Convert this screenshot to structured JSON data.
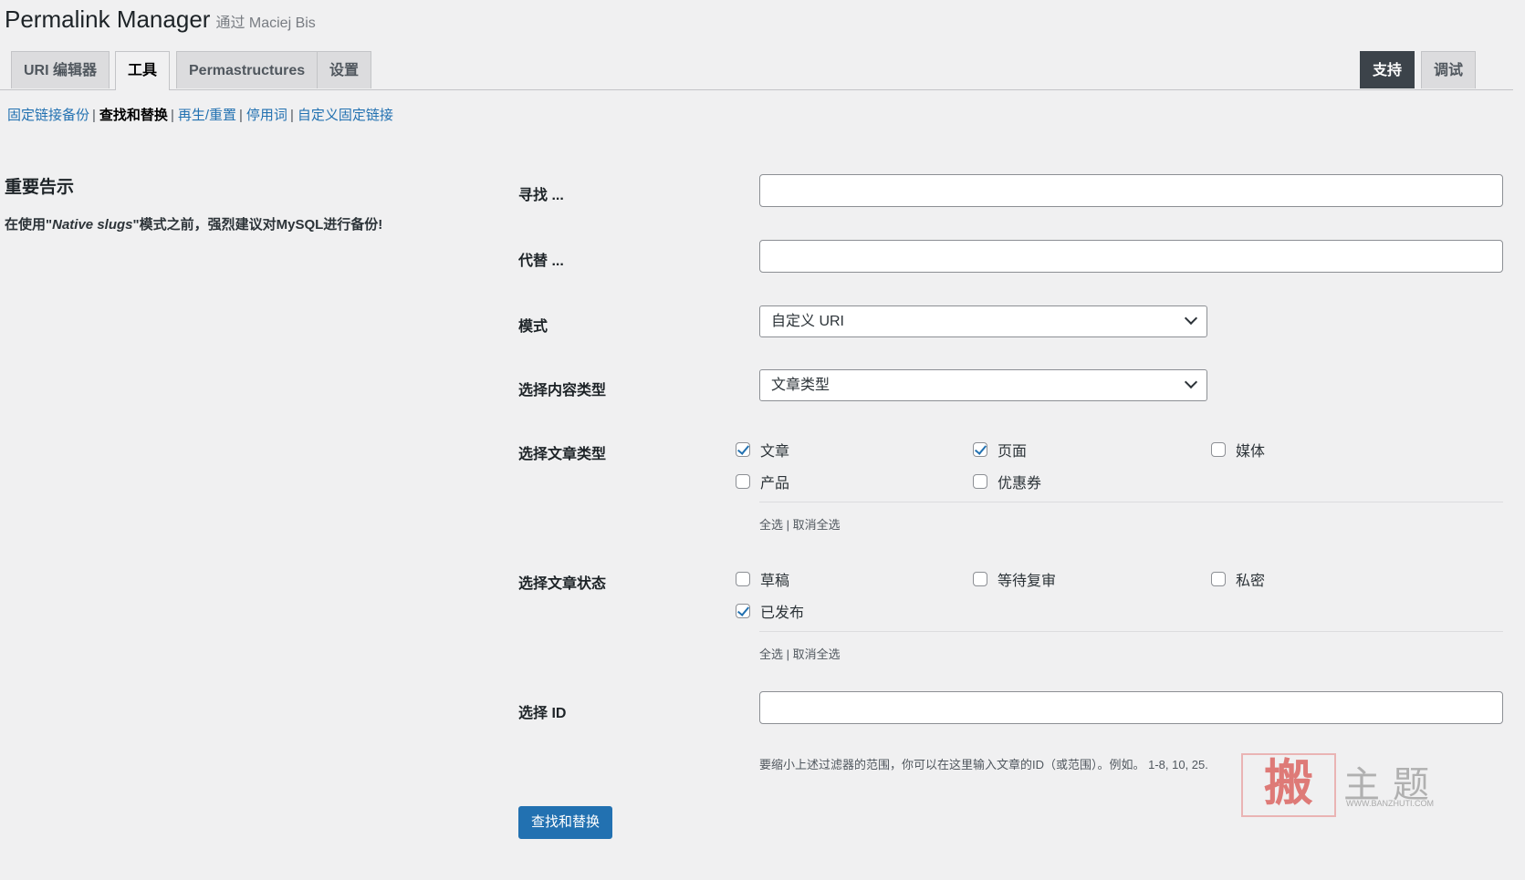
{
  "header": {
    "title": "Permalink Manager",
    "by": "通过 Maciej Bis"
  },
  "tabs": [
    {
      "label": "URI 编辑器"
    },
    {
      "label": "工具"
    },
    {
      "label": "Permastructures"
    },
    {
      "label": "设置"
    }
  ],
  "tabs_right": [
    {
      "label": "支持"
    },
    {
      "label": "调试"
    }
  ],
  "subnav": [
    {
      "label": "固定链接备份"
    },
    {
      "label": "查找和替换"
    },
    {
      "label": "再生/重置"
    },
    {
      "label": "停用词"
    },
    {
      "label": "自定义固定链接"
    }
  ],
  "subnav_sep": "|",
  "notice": {
    "heading": "重要告示",
    "prefix": "在使用\"",
    "italic": "Native slugs",
    "suffix": "\"模式之前，强烈建议对MySQL进行备份!"
  },
  "form": {
    "find_label": "寻找 ...",
    "find_value": "",
    "replace_label": "代替 ...",
    "replace_value": "",
    "mode_label": "模式",
    "mode_value": "自定义 URI",
    "content_type_label": "选择内容类型",
    "content_type_value": "文章类型",
    "post_types_label": "选择文章类型",
    "post_types": [
      {
        "label": "文章",
        "checked": true
      },
      {
        "label": "页面",
        "checked": true
      },
      {
        "label": "媒体",
        "checked": false
      },
      {
        "label": "产品",
        "checked": false
      },
      {
        "label": "优惠券",
        "checked": false
      }
    ],
    "post_status_label": "选择文章状态",
    "post_statuses": [
      {
        "label": "草稿",
        "checked": false
      },
      {
        "label": "等待复审",
        "checked": false
      },
      {
        "label": "私密",
        "checked": false
      },
      {
        "label": "已发布",
        "checked": true
      }
    ],
    "select_all": "全选 | 取消全选",
    "ids_label": "选择 ID",
    "ids_value": "",
    "ids_hint": "要缩小上述过滤器的范围，你可以在这里输入文章的ID（或范围）。例如。 1-8, 10, 25.",
    "submit_label": "查找和替换"
  },
  "watermark": {
    "seal": "搬",
    "text": "主题",
    "url": "WWW.BANZHUTI.COM"
  }
}
